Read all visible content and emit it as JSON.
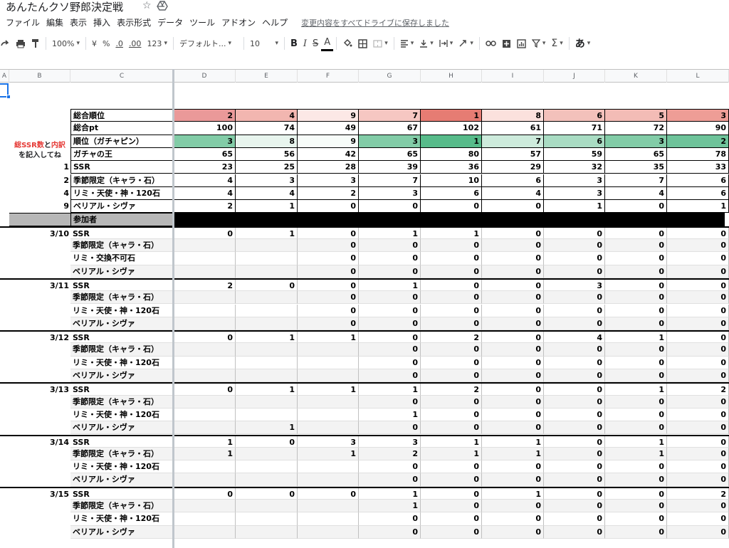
{
  "doc": {
    "title": "あんたんクソ野郎決定戦"
  },
  "menu": [
    "ファイル",
    "編集",
    "表示",
    "挿入",
    "表示形式",
    "データ",
    "ツール",
    "アドオン",
    "ヘルプ"
  ],
  "save_status": "変更内容をすべてドライブに保存しました",
  "toolbar": {
    "zoom": "100%",
    "currency": "¥",
    "percent": "%",
    "dec_dec": ".0",
    "dec_inc": ".00",
    "format": "123",
    "font": "デフォルト...",
    "font_size": "10",
    "bold": "B",
    "italic": "I",
    "strike": "S",
    "textcolor": "A",
    "input_method": "あ"
  },
  "columns": [
    "A",
    "B",
    "C",
    "D",
    "E",
    "F",
    "G",
    "H",
    "I",
    "J",
    "K",
    "L"
  ],
  "colors": {
    "rank_bg": [
      "#ea9999",
      "#f2b6b0",
      "#fce8e6",
      "#f6c7c2",
      "#e67c73",
      "#fbe1dd",
      "#f3c1bb",
      "#f3bcb6",
      "#ee9d96"
    ],
    "gacha_bg": [
      "#82cca7",
      "#e8f5ee",
      "#f7fcf9",
      "#82cca7",
      "#57bb8a",
      "#cdebdc",
      "#a9dcc3",
      "#82cca7",
      "#6ec39a"
    ]
  },
  "side_note": {
    "line1a": "総SSR数",
    "line1b": "と",
    "line1c": "内訳",
    "line2": "を記入してね"
  },
  "summary": [
    {
      "label": "総合順位",
      "values": [
        "2",
        "4",
        "9",
        "7",
        "1",
        "8",
        "6",
        "5",
        "3"
      ]
    },
    {
      "label": "総合pt",
      "values": [
        "100",
        "74",
        "49",
        "67",
        "102",
        "61",
        "71",
        "72",
        "90"
      ]
    },
    {
      "label": "順位（ガチャピン）",
      "values": [
        "3",
        "8",
        "9",
        "3",
        "1",
        "7",
        "6",
        "3",
        "2"
      ]
    },
    {
      "label": "ガチャの王",
      "values": [
        "65",
        "56",
        "42",
        "65",
        "80",
        "57",
        "59",
        "65",
        "78"
      ]
    },
    {
      "b": "1",
      "label": "SSR",
      "values": [
        "23",
        "25",
        "28",
        "39",
        "36",
        "29",
        "32",
        "35",
        "33"
      ]
    },
    {
      "b": "2",
      "label": "季節限定（キャラ・石）",
      "values": [
        "4",
        "3",
        "3",
        "7",
        "10",
        "6",
        "3",
        "7",
        "6"
      ]
    },
    {
      "b": "4",
      "label": "リミ・天使・神・120石",
      "values": [
        "4",
        "4",
        "2",
        "3",
        "6",
        "4",
        "3",
        "4",
        "6"
      ]
    },
    {
      "b": "9",
      "label": "ベリアル・シヴァ",
      "values": [
        "2",
        "1",
        "0",
        "0",
        "0",
        "0",
        "1",
        "0",
        "1"
      ]
    }
  ],
  "participants_label": "参加者",
  "days": [
    {
      "date": "3/10",
      "rows": [
        {
          "label": "SSR",
          "values": [
            "0",
            "1",
            "0",
            "1",
            "1",
            "0",
            "0",
            "0",
            "0"
          ]
        },
        {
          "label": "季節限定（キャラ・石）",
          "values": [
            "",
            "",
            "0",
            "0",
            "0",
            "0",
            "0",
            "0",
            "0"
          ]
        },
        {
          "label": "リミ・交換不可石",
          "values": [
            "",
            "",
            "0",
            "0",
            "0",
            "0",
            "0",
            "0",
            "0"
          ]
        },
        {
          "label": "ベリアル・シヴァ",
          "values": [
            "",
            "",
            "0",
            "0",
            "0",
            "0",
            "0",
            "0",
            "0"
          ]
        }
      ]
    },
    {
      "date": "3/11",
      "rows": [
        {
          "label": "SSR",
          "values": [
            "2",
            "0",
            "0",
            "1",
            "0",
            "0",
            "3",
            "0",
            "0"
          ]
        },
        {
          "label": "季節限定（キャラ・石）",
          "values": [
            "",
            "",
            "0",
            "0",
            "0",
            "0",
            "0",
            "0",
            "0"
          ]
        },
        {
          "label": "リミ・天使・神・120石",
          "values": [
            "",
            "",
            "0",
            "0",
            "0",
            "0",
            "0",
            "0",
            "0"
          ]
        },
        {
          "label": "ベリアル・シヴァ",
          "values": [
            "",
            "",
            "0",
            "0",
            "0",
            "0",
            "0",
            "0",
            "0"
          ]
        }
      ]
    },
    {
      "date": "3/12",
      "rows": [
        {
          "label": "SSR",
          "values": [
            "0",
            "1",
            "1",
            "0",
            "2",
            "0",
            "4",
            "1",
            "0"
          ]
        },
        {
          "label": "季節限定（キャラ・石）",
          "values": [
            "",
            "",
            "",
            "0",
            "0",
            "0",
            "0",
            "0",
            "0"
          ]
        },
        {
          "label": "リミ・天使・神・120石",
          "values": [
            "",
            "",
            "",
            "0",
            "0",
            "0",
            "0",
            "0",
            "0"
          ]
        },
        {
          "label": "ベリアル・シヴァ",
          "values": [
            "",
            "",
            "",
            "0",
            "0",
            "0",
            "0",
            "0",
            "0"
          ]
        }
      ]
    },
    {
      "date": "3/13",
      "rows": [
        {
          "label": "SSR",
          "values": [
            "0",
            "1",
            "1",
            "1",
            "2",
            "0",
            "0",
            "1",
            "2"
          ]
        },
        {
          "label": "季節限定（キャラ・石）",
          "values": [
            "",
            "",
            "",
            "0",
            "0",
            "0",
            "0",
            "0",
            "0"
          ]
        },
        {
          "label": "リミ・天使・神・120石",
          "values": [
            "",
            "",
            "",
            "1",
            "0",
            "0",
            "0",
            "0",
            "0"
          ]
        },
        {
          "label": "ベリアル・シヴァ",
          "values": [
            "",
            "1",
            "",
            "0",
            "0",
            "0",
            "0",
            "0",
            "0"
          ]
        }
      ]
    },
    {
      "date": "3/14",
      "rows": [
        {
          "label": "SSR",
          "values": [
            "1",
            "0",
            "3",
            "3",
            "1",
            "1",
            "0",
            "1",
            "0"
          ]
        },
        {
          "label": "季節限定（キャラ・石）",
          "values": [
            "1",
            "",
            "1",
            "2",
            "1",
            "1",
            "0",
            "1",
            "0"
          ]
        },
        {
          "label": "リミ・天使・神・120石",
          "values": [
            "",
            "",
            "",
            "0",
            "0",
            "0",
            "0",
            "0",
            "0"
          ]
        },
        {
          "label": "ベリアル・シヴァ",
          "values": [
            "",
            "",
            "",
            "0",
            "0",
            "0",
            "0",
            "0",
            "0"
          ]
        }
      ]
    },
    {
      "date": "3/15",
      "rows": [
        {
          "label": "SSR",
          "values": [
            "0",
            "0",
            "0",
            "1",
            "0",
            "1",
            "0",
            "0",
            "2"
          ]
        },
        {
          "label": "季節限定（キャラ・石）",
          "values": [
            "",
            "",
            "",
            "1",
            "0",
            "0",
            "0",
            "0",
            "0"
          ]
        },
        {
          "label": "リミ・天使・神・120石",
          "values": [
            "",
            "",
            "",
            "0",
            "0",
            "0",
            "0",
            "0",
            "0"
          ]
        },
        {
          "label": "ベリアル・シヴァ",
          "values": [
            "",
            "",
            "",
            "0",
            "0",
            "0",
            "0",
            "0",
            "0"
          ]
        }
      ]
    }
  ]
}
